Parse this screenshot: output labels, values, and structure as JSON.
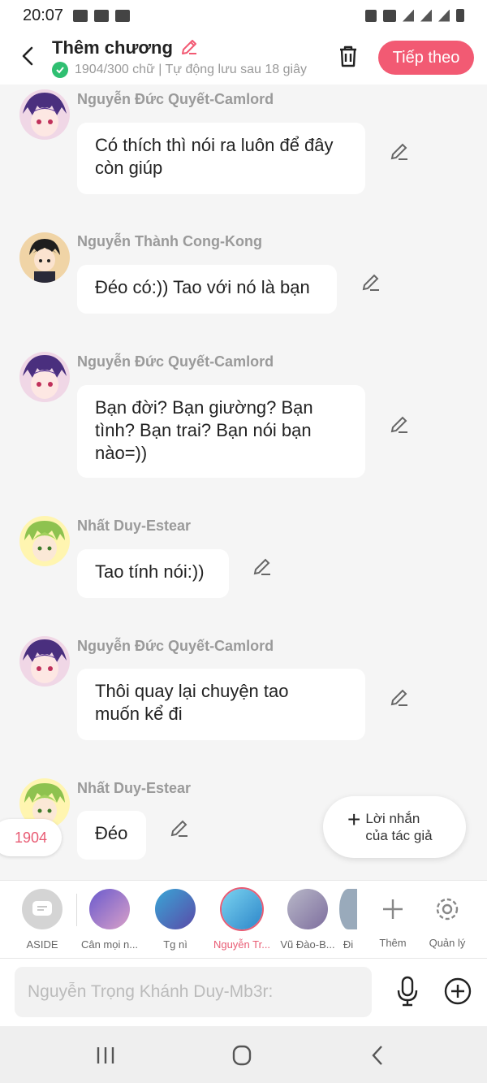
{
  "status_bar": {
    "time": "20:07"
  },
  "header": {
    "title": "Thêm chương",
    "subtitle": "1904/300 chữ | Tự động lưu sau 18 giây",
    "next_label": "Tiếp theo"
  },
  "messages": [
    {
      "name": "Nguyễn Đức Quyết-Camlord",
      "lines": [
        "Có thích thì nói ra luôn để đây",
        "còn giúp"
      ],
      "avatar": "purple-hair-avatar"
    },
    {
      "name": "Nguyễn Thành Cong-Kong",
      "lines": [
        "Đéo có:)) Tao với nó là bạn"
      ],
      "avatar": "dark-hair-avatar"
    },
    {
      "name": "Nguyễn Đức Quyết-Camlord",
      "lines": [
        "Bạn đời? Bạn giường? Bạn",
        "tình? Bạn trai? Bạn nói bạn",
        "nào=))"
      ],
      "avatar": "purple-hair-avatar"
    },
    {
      "name": "Nhất Duy-Estear",
      "lines": [
        "Tao tính nói:))"
      ],
      "avatar": "green-hair-avatar"
    },
    {
      "name": "Nguyễn Đức Quyết-Camlord",
      "lines": [
        "Thôi quay lại chuyện tao",
        "muốn kể đi"
      ],
      "avatar": "purple-hair-avatar"
    },
    {
      "name": "Nhất Duy-Estear",
      "lines": [
        "Đéo"
      ],
      "avatar": "green-hair-avatar"
    }
  ],
  "word_count_pill": "1904",
  "author_note": {
    "line1": "Lời nhắn",
    "line2": "của tác giả"
  },
  "characters": [
    {
      "label": "ASIDE"
    },
    {
      "label": "Cân mọi n..."
    },
    {
      "label": "Tg nì"
    },
    {
      "label": "Nguyễn Tr..."
    },
    {
      "label": "Vũ Đào-B..."
    },
    {
      "label": "Đi"
    },
    {
      "label": "Thêm"
    },
    {
      "label": "Quản lý"
    }
  ],
  "input": {
    "placeholder": "Nguyễn Trọng Khánh Duy-Mb3r:"
  },
  "colors": {
    "accent": "#f25a73",
    "check": "#2fbf71"
  }
}
